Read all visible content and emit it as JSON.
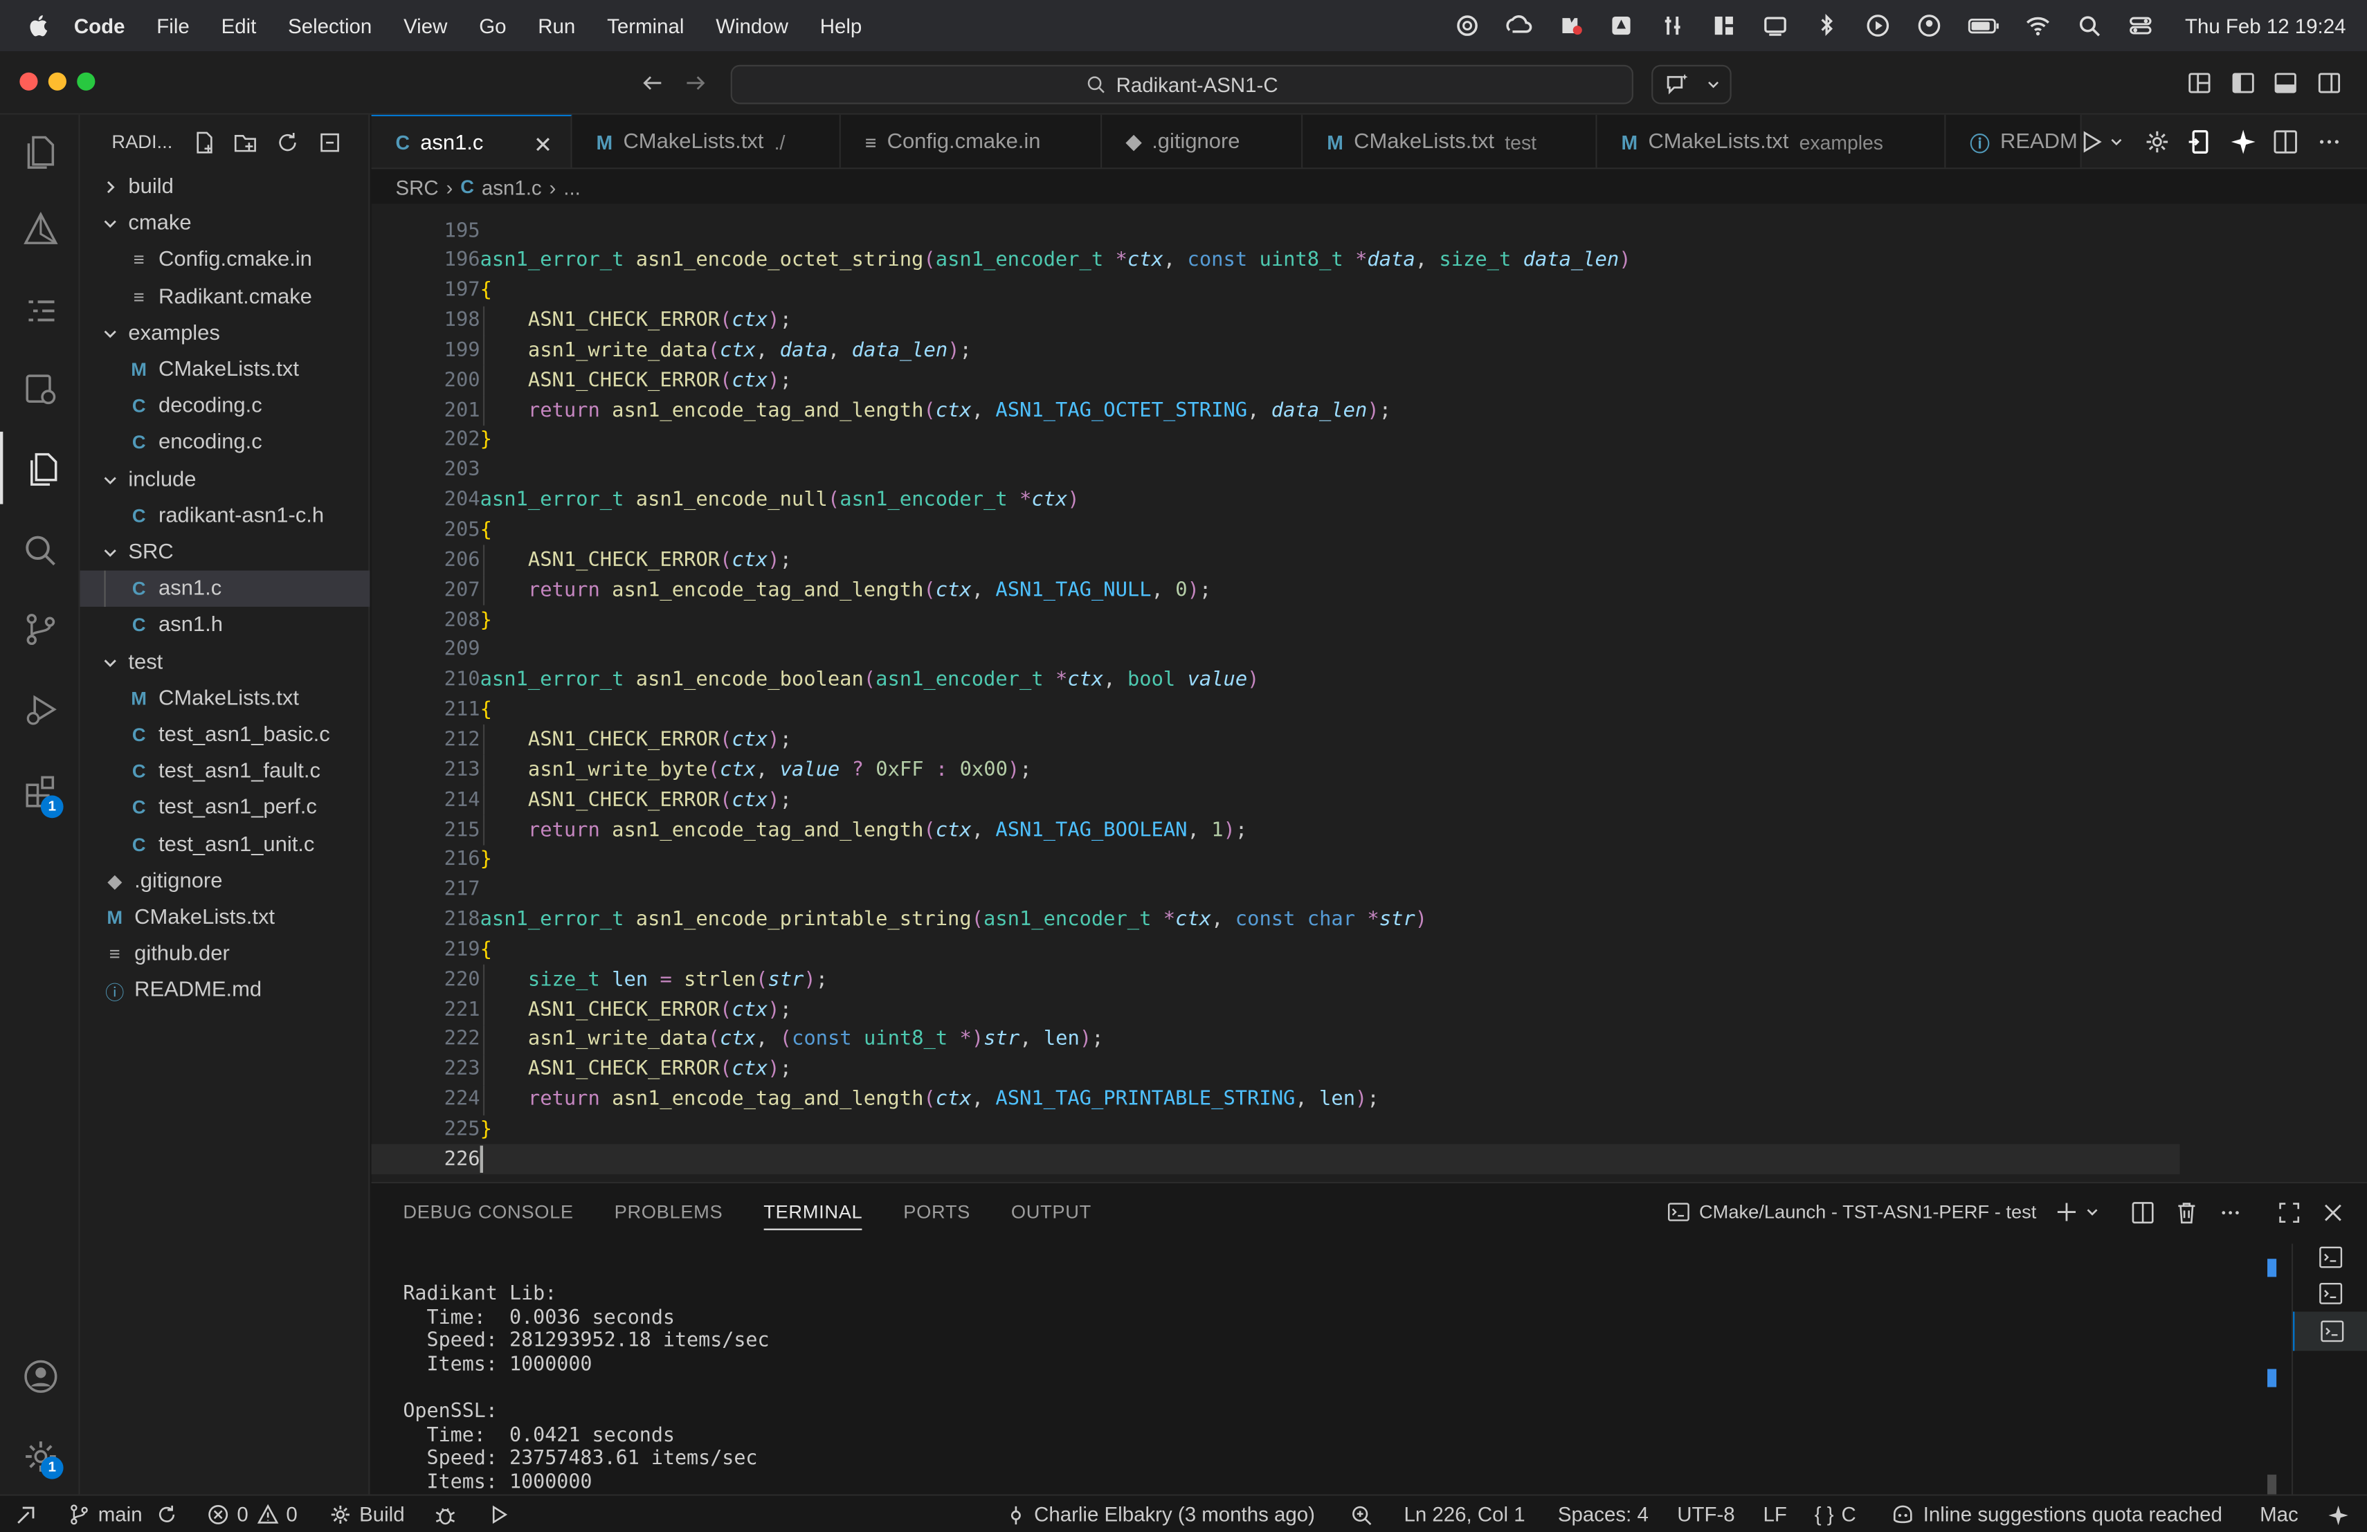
{
  "menubar": {
    "app": "Code",
    "menus": [
      "File",
      "Edit",
      "Selection",
      "View",
      "Go",
      "Run",
      "Terminal",
      "Window",
      "Help"
    ],
    "clock": "Thu Feb 12  19:24"
  },
  "titlebar": {
    "search": "Radikant-ASN1-C"
  },
  "sidebar": {
    "title": "RADI...",
    "items": [
      {
        "label": "build",
        "kind": "folder",
        "open": false,
        "depth": 0
      },
      {
        "label": "cmake",
        "kind": "folder",
        "open": true,
        "depth": 0
      },
      {
        "label": "Config.cmake.in",
        "kind": "text",
        "depth": 1
      },
      {
        "label": "Radikant.cmake",
        "kind": "text",
        "depth": 1
      },
      {
        "label": "examples",
        "kind": "folder",
        "open": true,
        "depth": 0
      },
      {
        "label": "CMakeLists.txt",
        "kind": "cmake",
        "depth": 1
      },
      {
        "label": "decoding.c",
        "kind": "c",
        "depth": 1
      },
      {
        "label": "encoding.c",
        "kind": "c",
        "depth": 1
      },
      {
        "label": "include",
        "kind": "folder",
        "open": true,
        "depth": 0
      },
      {
        "label": "radikant-asn1-c.h",
        "kind": "c",
        "depth": 1
      },
      {
        "label": "SRC",
        "kind": "folder",
        "open": true,
        "depth": 0
      },
      {
        "label": "asn1.c",
        "kind": "c",
        "depth": 1,
        "selected": true
      },
      {
        "label": "asn1.h",
        "kind": "c",
        "depth": 1
      },
      {
        "label": "test",
        "kind": "folder",
        "open": true,
        "depth": 0
      },
      {
        "label": "CMakeLists.txt",
        "kind": "cmake",
        "depth": 1
      },
      {
        "label": "test_asn1_basic.c",
        "kind": "c",
        "depth": 1
      },
      {
        "label": "test_asn1_fault.c",
        "kind": "c",
        "depth": 1
      },
      {
        "label": "test_asn1_perf.c",
        "kind": "c",
        "depth": 1
      },
      {
        "label": "test_asn1_unit.c",
        "kind": "c",
        "depth": 1
      },
      {
        "label": ".gitignore",
        "kind": "git",
        "depth": 0
      },
      {
        "label": "CMakeLists.txt",
        "kind": "cmake",
        "depth": 0
      },
      {
        "label": "github.der",
        "kind": "text",
        "depth": 0
      },
      {
        "label": "README.md",
        "kind": "info",
        "depth": 0
      }
    ]
  },
  "tabs": [
    {
      "label": "asn1.c",
      "desc": "",
      "icon": "C",
      "active": true
    },
    {
      "label": "CMakeLists.txt",
      "desc": "./",
      "icon": "M"
    },
    {
      "label": "Config.cmake.in",
      "desc": "",
      "icon": "≡"
    },
    {
      "label": ".gitignore",
      "desc": "",
      "icon": "◆"
    },
    {
      "label": "CMakeLists.txt",
      "desc": "test",
      "icon": "M"
    },
    {
      "label": "CMakeLists.txt",
      "desc": "examples",
      "icon": "M"
    },
    {
      "label": "READM",
      "desc": "",
      "icon": "ⓘ"
    }
  ],
  "breadcrumb": {
    "folder": "SRC",
    "file": "asn1.c",
    "more": "..."
  },
  "editor": {
    "cursor_line": 226,
    "lines": [
      {
        "n": "195",
        "t": ""
      },
      {
        "n": "196",
        "t": "asn1_error_t asn1_encode_octet_string(asn1_encoder_t *ctx, const uint8_t *data, size_t data_len)"
      },
      {
        "n": "197",
        "t": "{"
      },
      {
        "n": "198",
        "t": "    ASN1_CHECK_ERROR(ctx);"
      },
      {
        "n": "199",
        "t": "    asn1_write_data(ctx, data, data_len);"
      },
      {
        "n": "200",
        "t": "    ASN1_CHECK_ERROR(ctx);"
      },
      {
        "n": "201",
        "t": "    return asn1_encode_tag_and_length(ctx, ASN1_TAG_OCTET_STRING, data_len);"
      },
      {
        "n": "202",
        "t": "}"
      },
      {
        "n": "203",
        "t": ""
      },
      {
        "n": "204",
        "t": "asn1_error_t asn1_encode_null(asn1_encoder_t *ctx)"
      },
      {
        "n": "205",
        "t": "{"
      },
      {
        "n": "206",
        "t": "    ASN1_CHECK_ERROR(ctx);"
      },
      {
        "n": "207",
        "t": "    return asn1_encode_tag_and_length(ctx, ASN1_TAG_NULL, 0);"
      },
      {
        "n": "208",
        "t": "}"
      },
      {
        "n": "209",
        "t": ""
      },
      {
        "n": "210",
        "t": "asn1_error_t asn1_encode_boolean(asn1_encoder_t *ctx, bool value)"
      },
      {
        "n": "211",
        "t": "{"
      },
      {
        "n": "212",
        "t": "    ASN1_CHECK_ERROR(ctx);"
      },
      {
        "n": "213",
        "t": "    asn1_write_byte(ctx, value ? 0xFF : 0x00);"
      },
      {
        "n": "214",
        "t": "    ASN1_CHECK_ERROR(ctx);"
      },
      {
        "n": "215",
        "t": "    return asn1_encode_tag_and_length(ctx, ASN1_TAG_BOOLEAN, 1);"
      },
      {
        "n": "216",
        "t": "}"
      },
      {
        "n": "217",
        "t": ""
      },
      {
        "n": "218",
        "t": "asn1_error_t asn1_encode_printable_string(asn1_encoder_t *ctx, const char *str)"
      },
      {
        "n": "219",
        "t": "{"
      },
      {
        "n": "220",
        "t": "    size_t len = strlen(str);"
      },
      {
        "n": "221",
        "t": "    ASN1_CHECK_ERROR(ctx);"
      },
      {
        "n": "222",
        "t": "    asn1_write_data(ctx, (const uint8_t *)str, len);"
      },
      {
        "n": "223",
        "t": "    ASN1_CHECK_ERROR(ctx);"
      },
      {
        "n": "224",
        "t": "    return asn1_encode_tag_and_length(ctx, ASN1_TAG_PRINTABLE_STRING, len);"
      },
      {
        "n": "225",
        "t": "}"
      },
      {
        "n": "226",
        "t": ""
      }
    ]
  },
  "panel": {
    "tabs": [
      "DEBUG CONSOLE",
      "PROBLEMS",
      "TERMINAL",
      "PORTS",
      "OUTPUT"
    ],
    "active_tab": "TERMINAL",
    "terminal_name": "CMake/Launch - TST-ASN1-PERF - test",
    "terminal_lines": [
      "Radikant Lib:",
      "  Time:  0.0036 seconds",
      "  Speed: 281293952.18 items/sec",
      "  Items: 1000000",
      "",
      "OpenSSL:",
      "  Time:  0.0421 seconds",
      "  Speed: 23757483.61 items/sec",
      "  Items: 1000000"
    ]
  },
  "statusbar": {
    "branch": "main",
    "errors": "0",
    "warnings": "0",
    "build": "Build",
    "blame": "Charlie Elbakry (3 months ago)",
    "position": "Ln 226, Col 1",
    "spaces": "Spaces: 4",
    "encoding": "UTF-8",
    "eol": "LF",
    "language": "C",
    "copilot": "Inline suggestions quota reached",
    "platform": "Mac"
  },
  "badges": {
    "extensions": "1",
    "settings": "1"
  },
  "colors": {
    "accent": "#0078d4",
    "editor_bg": "#1f1f1f",
    "keyword": "#569cd6",
    "type": "#4ec9b0",
    "function": "#dcdcaa",
    "param": "#9cdcfe",
    "macro": "#4fc1ff",
    "number": "#b5cea8",
    "control": "#c586c0"
  }
}
